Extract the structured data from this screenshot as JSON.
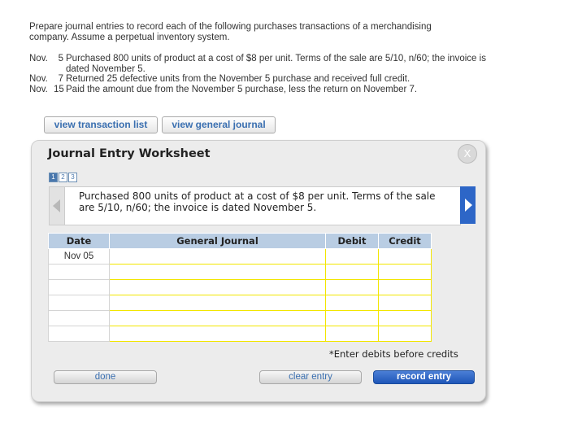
{
  "prompt": {
    "line1": "Prepare journal entries to record each of the following purchases transactions of a merchandising",
    "line2": "company. Assume a perpetual inventory system."
  },
  "transactions": [
    {
      "month": "Nov.",
      "day": "5",
      "description": "Purchased 800 units of product at a cost of $8 per unit. Terms of the sale are 5/10, n/60; the invoice is dated November 5."
    },
    {
      "month": "Nov.",
      "day": "7",
      "description": "Returned 25 defective units from the November 5 purchase and received full credit."
    },
    {
      "month": "Nov.",
      "day": "15",
      "description": "Paid the amount due from the November 5 purchase, less the return on November 7."
    }
  ],
  "top_buttons": {
    "view_transaction_list": "view transaction list",
    "view_general_journal": "view general journal"
  },
  "worksheet": {
    "title": "Journal Entry Worksheet",
    "close_label": "X",
    "steps": [
      "1",
      "2",
      "3"
    ],
    "active_step": 1,
    "description": "Purchased 800 units of product at a cost of $8 per unit. Terms of the sale are 5/10, n/60; the invoice is dated November 5.",
    "table": {
      "headers": [
        "Date",
        "General Journal",
        "Debit",
        "Credit"
      ],
      "rows": [
        {
          "date": "Nov 05",
          "account": "",
          "debit": "",
          "credit": ""
        },
        {
          "date": "",
          "account": "",
          "debit": "",
          "credit": ""
        },
        {
          "date": "",
          "account": "",
          "debit": "",
          "credit": ""
        },
        {
          "date": "",
          "account": "",
          "debit": "",
          "credit": ""
        },
        {
          "date": "",
          "account": "",
          "debit": "",
          "credit": ""
        },
        {
          "date": "",
          "account": "",
          "debit": "",
          "credit": ""
        }
      ]
    },
    "note": "*Enter debits before credits",
    "buttons": {
      "done": "done",
      "clear_entry": "clear entry",
      "record_entry": "record entry"
    }
  },
  "colors": {
    "link_blue": "#3a6fb0",
    "header_blue": "#b9cde3",
    "input_yellow": "#f2e600",
    "primary_blue": "#2d66c7"
  }
}
